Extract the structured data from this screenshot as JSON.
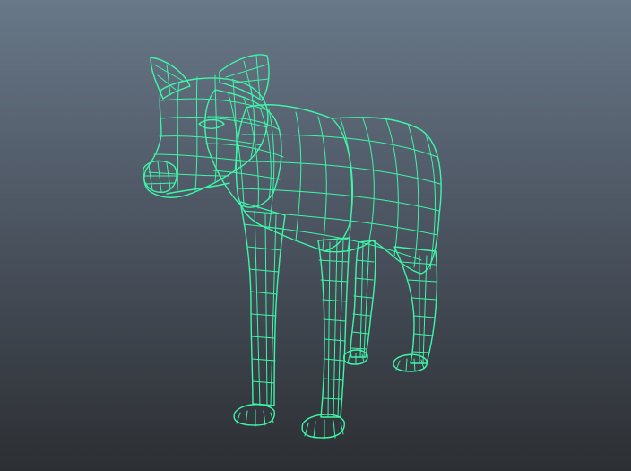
{
  "viewport": {
    "background_top": "#687888",
    "background_bottom": "#2c2f33",
    "wireframe_color": "#3ef5a8",
    "shading_color": "#5c5c5c",
    "selected_object": "wolf-mesh"
  }
}
